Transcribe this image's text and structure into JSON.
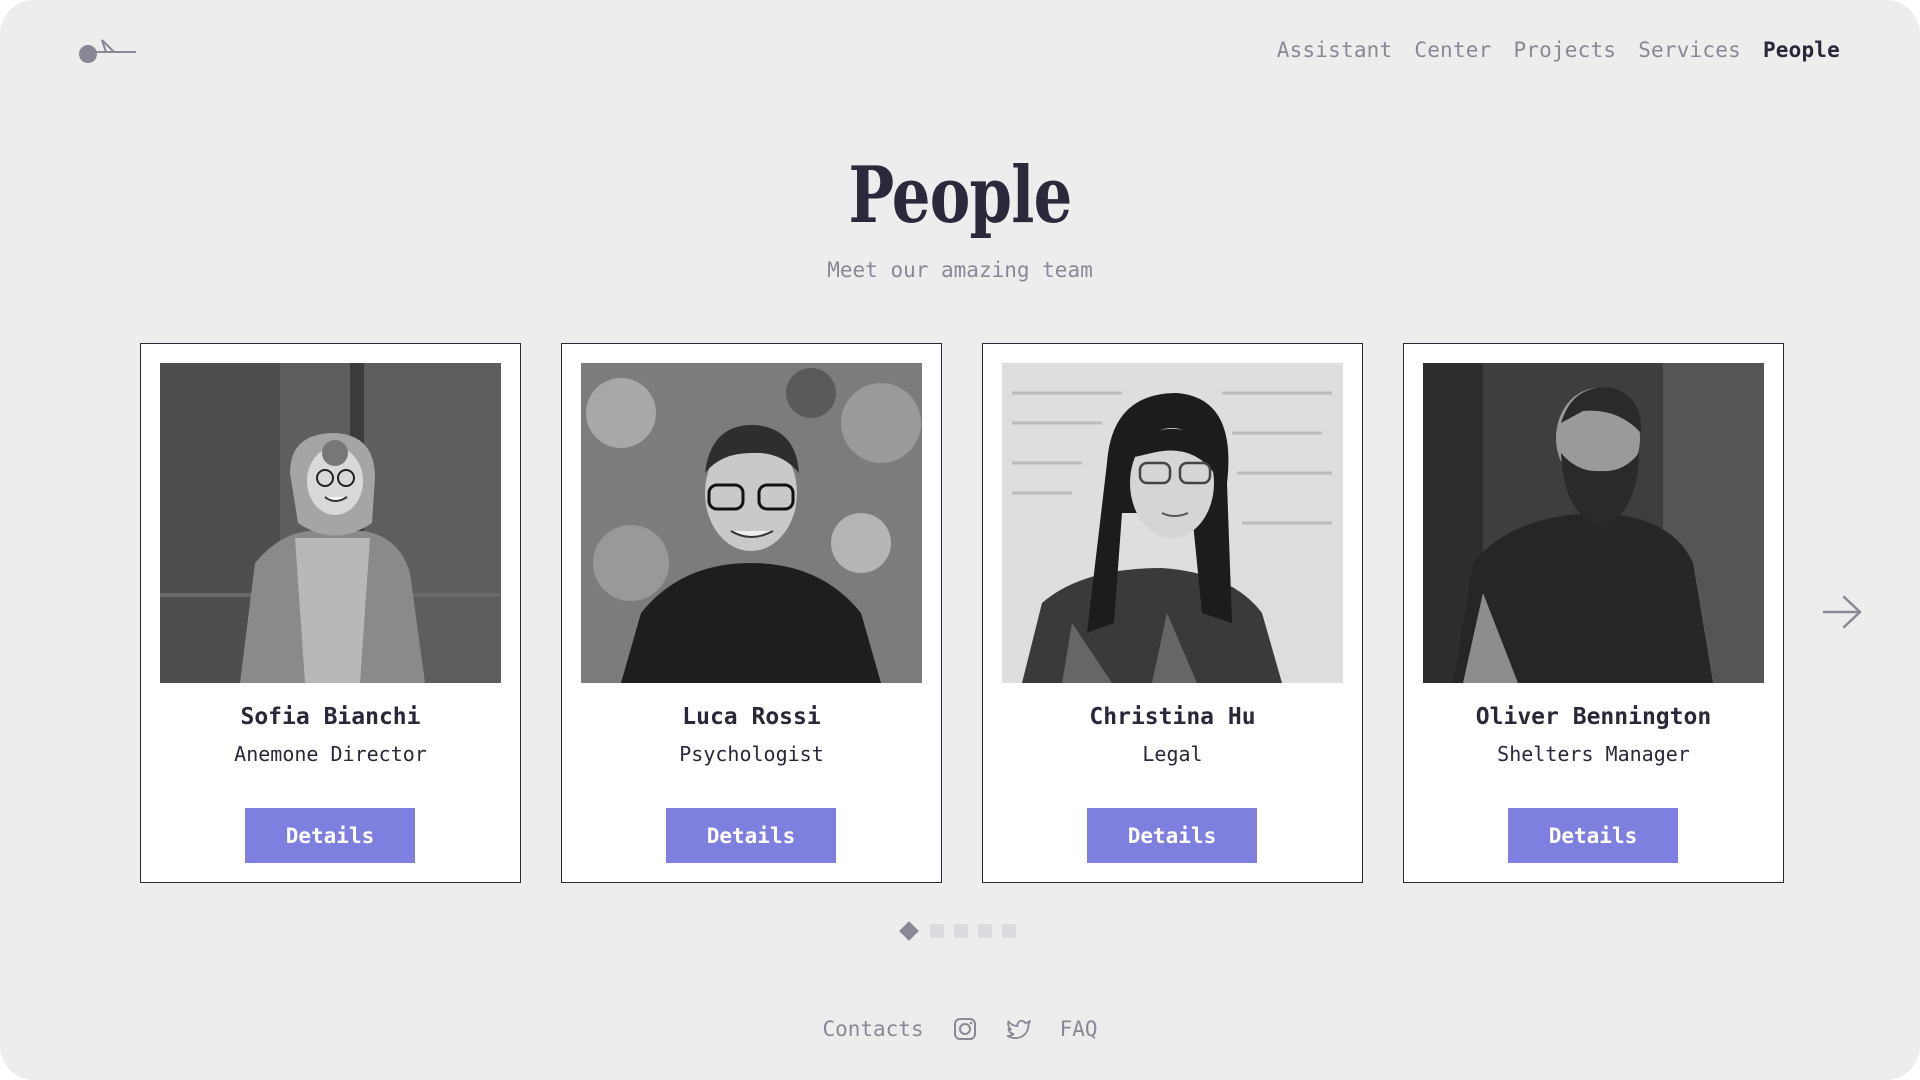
{
  "header": {
    "logo_icon": "bird-logo-icon",
    "nav": [
      {
        "label": "Assistant",
        "active": false
      },
      {
        "label": "Center",
        "active": false
      },
      {
        "label": "Projects",
        "active": false
      },
      {
        "label": "Services",
        "active": false
      },
      {
        "label": "People",
        "active": true
      }
    ]
  },
  "hero": {
    "title": "People",
    "subtitle": "Meet our amazing team"
  },
  "people": [
    {
      "name": "Sofia Bianchi",
      "role": "Anemone Director",
      "button": "Details"
    },
    {
      "name": "Luca Rossi",
      "role": "Psychologist",
      "button": "Details"
    },
    {
      "name": "Christina Hu",
      "role": "Legal",
      "button": "Details"
    },
    {
      "name": "Oliver Bennington",
      "role": "Shelters Manager",
      "button": "Details"
    }
  ],
  "carousel": {
    "next_icon": "arrow-right-icon",
    "page_count": 5,
    "current_page": 1
  },
  "footer": {
    "contacts": "Contacts",
    "instagram_icon": "instagram-icon",
    "twitter_icon": "twitter-icon",
    "faq": "FAQ"
  },
  "colors": {
    "background": "#ededee",
    "accent": "#7f7fe0",
    "text_dark": "#2a2838",
    "text_muted": "#8b8795"
  }
}
